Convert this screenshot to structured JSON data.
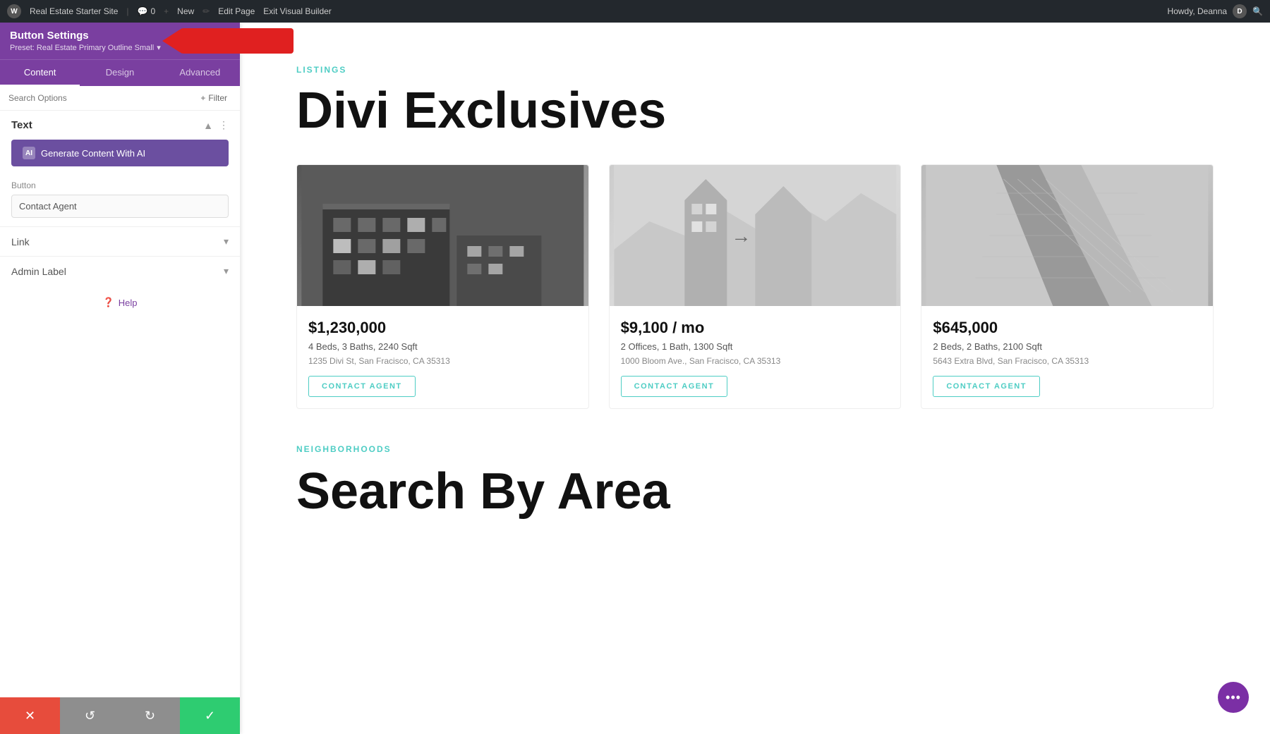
{
  "adminBar": {
    "wpLabel": "W",
    "siteName": "Real Estate Starter Site",
    "comments": "0",
    "newLabel": "New",
    "editPage": "Edit Page",
    "exitBuilder": "Exit Visual Builder",
    "howdy": "Howdy, Deanna"
  },
  "sidebar": {
    "title": "Button Settings",
    "preset": "Preset: Real Estate Primary Outline Small",
    "tabs": [
      "Content",
      "Design",
      "Advanced"
    ],
    "activeTab": "Content",
    "searchPlaceholder": "Search Options",
    "filterLabel": "Filter",
    "textSection": {
      "title": "Text",
      "aiButton": "Generate Content With AI",
      "aiIconLabel": "AI"
    },
    "buttonSection": {
      "title": "Button",
      "value": "Contact Agent"
    },
    "linkSection": {
      "title": "Link"
    },
    "adminLabelSection": {
      "title": "Admin Label"
    },
    "helpLabel": "Help",
    "bottomBar": {
      "cancel": "✕",
      "undo": "↺",
      "redo": "↻",
      "save": "✓"
    }
  },
  "mainContent": {
    "listingsLabel": "LISTINGS",
    "pageTitle": "Divi Exclusives",
    "properties": [
      {
        "price": "$1,230,000",
        "details": "4 Beds, 3 Baths, 2240 Sqft",
        "address": "1235 Divi St, San Fracisco, CA 35313",
        "contactBtn": "CONTACT AGENT",
        "imgType": "building-dark"
      },
      {
        "price": "$9,100 / mo",
        "details": "2 Offices, 1 Bath, 1300 Sqft",
        "address": "1000 Bloom Ave., San Fracisco, CA 35313",
        "contactBtn": "CONTACT AGENT",
        "imgType": "building-light"
      },
      {
        "price": "$645,000",
        "details": "2 Beds, 2 Baths, 2100 Sqft",
        "address": "5643 Extra Blvd, San Fracisco, CA 35313",
        "contactBtn": "CONTACT AGENT",
        "imgType": "building-gray"
      }
    ],
    "neighborhoodsLabel": "NEIGHBORHOODS",
    "neighborhoodsTitle": "Search By Area"
  },
  "colors": {
    "accent": "#4ecdc4",
    "purple": "#7a3fa0",
    "aiPurple": "#6b4fa0",
    "cancelRed": "#e74c3c",
    "saveGreen": "#2ecc71",
    "grayBtn": "#8e8e8e"
  }
}
